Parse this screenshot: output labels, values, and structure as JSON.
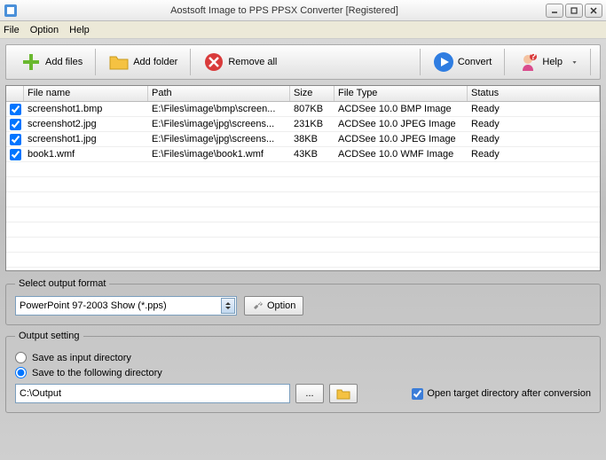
{
  "window": {
    "title": "Aostsoft Image to PPS PPSX Converter [Registered]"
  },
  "menu": {
    "file": "File",
    "option": "Option",
    "help": "Help"
  },
  "toolbar": {
    "add_files": "Add files",
    "add_folder": "Add folder",
    "remove_all": "Remove all",
    "convert": "Convert",
    "help": "Help"
  },
  "columns": {
    "filename": "File name",
    "path": "Path",
    "size": "Size",
    "filetype": "File Type",
    "status": "Status"
  },
  "rows": [
    {
      "checked": true,
      "name": "screenshot1.bmp",
      "path": "E:\\Files\\image\\bmp\\screen...",
      "size": "807KB",
      "type": "ACDSee 10.0 BMP Image",
      "status": "Ready"
    },
    {
      "checked": true,
      "name": "screenshot2.jpg",
      "path": "E:\\Files\\image\\jpg\\screens...",
      "size": "231KB",
      "type": "ACDSee 10.0 JPEG Image",
      "status": "Ready"
    },
    {
      "checked": true,
      "name": "screenshot1.jpg",
      "path": "E:\\Files\\image\\jpg\\screens...",
      "size": "38KB",
      "type": "ACDSee 10.0 JPEG Image",
      "status": "Ready"
    },
    {
      "checked": true,
      "name": "book1.wmf",
      "path": "E:\\Files\\image\\book1.wmf",
      "size": "43KB",
      "type": "ACDSee 10.0 WMF Image",
      "status": "Ready"
    }
  ],
  "format": {
    "legend": "Select output format",
    "selected": "PowerPoint 97-2003 Show (*.pps)",
    "option_btn": "Option"
  },
  "output": {
    "legend": "Output setting",
    "save_input": "Save as input directory",
    "save_following": "Save to the following directory",
    "path": "C:\\Output",
    "open_after": "Open target directory after conversion"
  }
}
